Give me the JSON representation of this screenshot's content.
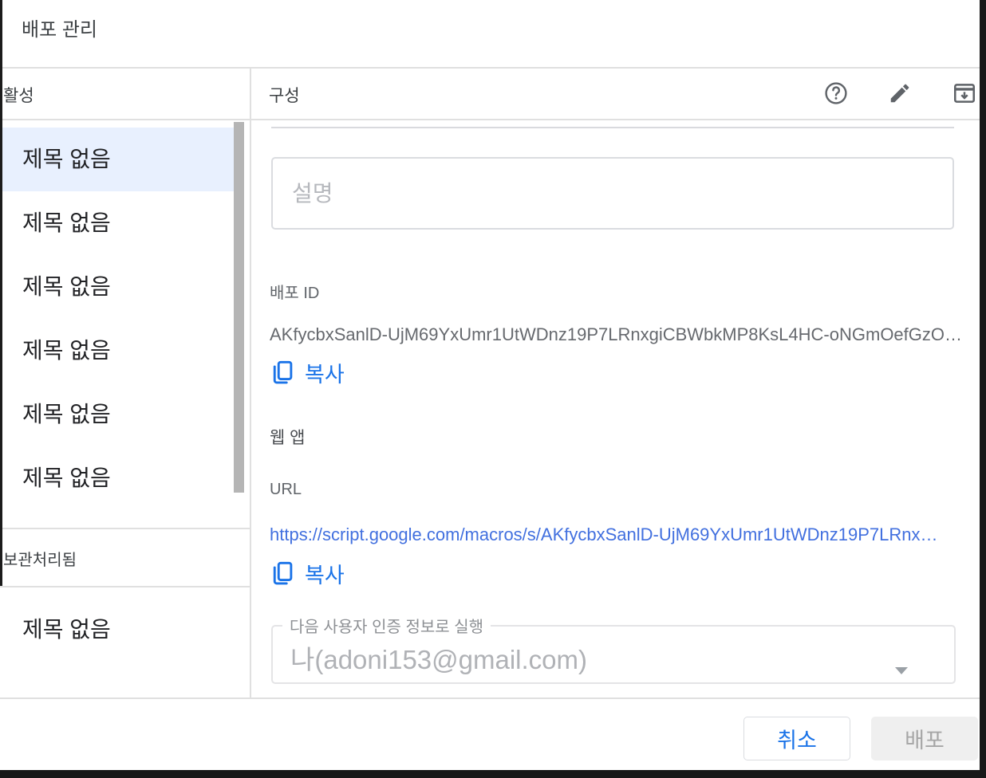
{
  "dialog": {
    "title": "배포 관리"
  },
  "sidebar": {
    "header": "활성",
    "active_items": [
      "제목 없음",
      "제목 없음",
      "제목 없음",
      "제목 없음",
      "제목 없음",
      "제목 없음"
    ],
    "archived_header": "보관처리됨",
    "archived_items": [
      "제목 없음"
    ]
  },
  "config": {
    "header": "구성",
    "toolbar_icons": [
      "help-icon",
      "edit-pencil-icon",
      "archive-icon"
    ],
    "description_placeholder": "설명",
    "deployment_id_label": "배포 ID",
    "deployment_id": "AKfycbxSanlD-UjM69YxUmr1UtWDnz19P7LRnxgiCBWbkMP8KsL4HC-oNGmOefGzO…",
    "copy_label": "복사",
    "web_app_label": "웹 앱",
    "url_label": "URL",
    "url": "https://script.google.com/macros/s/AKfycbxSanlD-UjM69YxUmr1UtWDnz19P7LRnx…",
    "execute_as": {
      "label": "다음 사용자 인증 정보로 실행",
      "value": "나(adoni153@gmail.com)"
    }
  },
  "footer": {
    "cancel_label": "취소",
    "deploy_label": "배포"
  },
  "colors": {
    "accent_blue": "#1a73e8",
    "link_blue": "#4270df",
    "selected_item_bg": "#e8f0fe",
    "divider": "#e0e0e0",
    "disabled_text": "#a6a6a6"
  }
}
